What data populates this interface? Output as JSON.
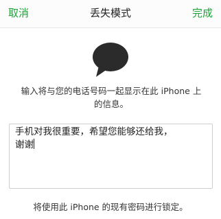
{
  "nav": {
    "cancel_label": "取消",
    "title": "丢失模式",
    "done_label": "完成"
  },
  "icon": {
    "name": "speech-bubble-icon",
    "color": "#2b2b2b"
  },
  "description": {
    "line1": "输入将与您的电话号码一起显示在此 iPhone 上",
    "line2": "的信息。"
  },
  "message": {
    "line1": "手机对我很重要，希望您能够还给我，",
    "line2": "谢谢"
  },
  "footer": {
    "note": "将使用此 iPhone 的现有密码进行锁定。"
  },
  "colors": {
    "accent": "#1aa336"
  }
}
